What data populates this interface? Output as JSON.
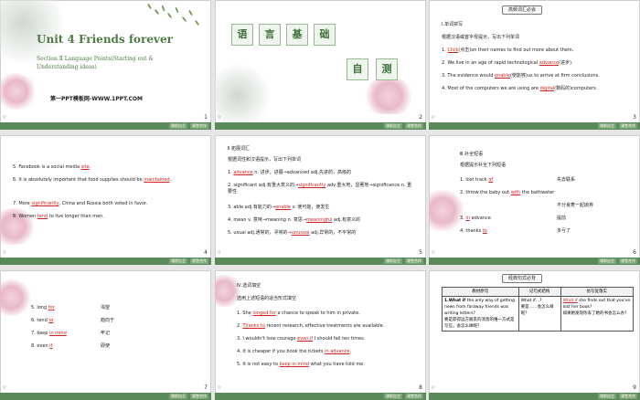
{
  "slides": [
    {
      "num": "1",
      "title": "Unit 4   Friends forever",
      "section": "Section Ⅱ   Language Points(Starting out & Understanding ideas)",
      "brand": "第一PPT模板网-WWW.1PPT.COM"
    },
    {
      "num": "2",
      "h1": "语",
      "h2": "言",
      "h3": "基",
      "h4": "础",
      "h5": "自",
      "h6": "测"
    },
    {
      "num": "3",
      "header": "高频词汇必会",
      "heading": "Ⅰ.单词拼写",
      "instr": "根据汉语或首字母提示，写出下列单词",
      "l1a": "1.  ",
      "l1ans": "Click",
      "l1b": "(点击)on their names to find out more about them.",
      "l2a": "2.  We live in an age of rapid technological ",
      "l2ans": "advance",
      "l2b": "(进步).",
      "l3a": "3.  The evidence would ",
      "l3ans": "enable",
      "l3b": "(使能够)us to arrive at firm conclusions.",
      "l4a": "4.  Most of the computers we are using are ",
      "l4ans": "digital",
      "l4b": "(数码的)computers."
    },
    {
      "num": "4",
      "l5a": "5.  Facebook is a social media ",
      "l5ans": "site",
      "l5b": ".",
      "l6a": "6.  It is absolutely important that food supplies should be ",
      "l6ans": "maintained",
      "l6b": ".",
      "l7a": "7.  More ",
      "l7ans": "significantly",
      "l7b": ", China and Russia both voted in favor.",
      "l8a": "8.  Women ",
      "l8ans": "tend",
      "l8b": " to live longer than men."
    },
    {
      "num": "5",
      "heading": "Ⅱ.拓展词汇",
      "instr": "根据词性和汉语提示，写出下列单词",
      "e1a": "1.  ",
      "e1ans": "advance",
      "e1b": " n. 进步，进展→advanced adj.先进的，高级的",
      "e2a": "2.  significant adj.有重大意义的→",
      "e2ans": "significantly",
      "e2b": " adv.重大地，显著地→significance n. 重要性",
      "e3a": "3.  able adj.有能力的→",
      "e3ans": "enable",
      "e3b": " v. 使可能，使发生",
      "e4a": "4.  mean v. 意味→meaning n. 意思→",
      "e4ans": "meaningful",
      "e4b": " adj.有意义的",
      "e5a": "5.  usual adj.通常的，寻常的→",
      "e5ans": "unusual",
      "e5b": " adj.异常的，不平常的"
    },
    {
      "num": "6",
      "heading": "Ⅲ.补全短语",
      "instr": "根据提示补全下列短语",
      "p1a": "1.  lost track ",
      "p1ans": "of",
      "p1c": "失去联系",
      "p2a": "2.  throw the baby out ",
      "p2ans": "with",
      "p2b": " the bathwater",
      "p2c": "不分良莠一起抛弃",
      "p3a": "3.  ",
      "p3ans": "in",
      "p3b": " advance",
      "p3c": "提前",
      "p4a": "4.  thanks ",
      "p4ans": "to",
      "p4c": "多亏了"
    },
    {
      "num": "7",
      "q5": "5.  long ",
      "q5ans": "for",
      "q5c": "渴望",
      "q6": "6.  tend ",
      "q6ans": "to",
      "q6c": "趋向于",
      "q7": "7.  keep ",
      "q7ans": "in mind",
      "q7c": "牢记",
      "q8": "8.  even ",
      "q8ans": "if",
      "q8c": "即使"
    },
    {
      "num": "8",
      "heading": "Ⅳ.选词填空",
      "instr": "选用上述短语的适当形式填空",
      "f1a": "1.  She ",
      "f1ans": "longed for",
      "f1b": " a chance to speak to him in private.",
      "f2a": "2.  ",
      "f2ans": "Thanks to",
      "f2b": " recent research, effective treatments are available.",
      "f3a": "3.  I wouldn't lose courage ",
      "f3ans": "even if",
      "f3b": " I should fail ten times.",
      "f4a": "4.  It is cheaper if you book the tickets ",
      "f4ans": "in advance",
      "f4b": ".",
      "f5a": "5.  It is not easy to ",
      "f5ans": "keep in mind",
      "f5b": " what you have told me."
    },
    {
      "num": "9",
      "header": "经典句式必背",
      "th1": "教材原句",
      "th2": "记句式结构",
      "th3": "仿写促落实",
      "c1a": "1.What if",
      "c1b": " the only way of getting news from faraway friends was writing letters?",
      "c1c": "要是获得远方朋友的消息的唯一方式是写信，会怎么样呢？",
      "c2a": "What if…?",
      "c2b": "要是……会怎么样呢？",
      "c3ans": "What if",
      "c3b": " she finds out that you've lost her book?",
      "c3c": "如果她发现你丢了她的书会怎么办？"
    }
  ],
  "footer": {
    "btn1": "课前自主",
    "btn2": "课堂合作"
  }
}
